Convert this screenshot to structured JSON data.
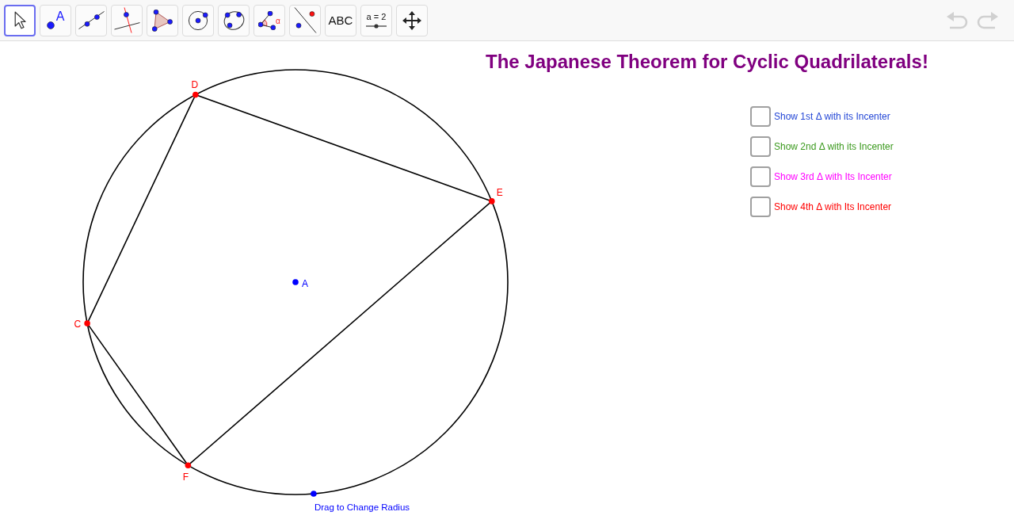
{
  "toolbar": {
    "tools": [
      {
        "kind": "move",
        "selected": true
      },
      {
        "kind": "point",
        "label": "A",
        "selected": false
      },
      {
        "kind": "line",
        "selected": false
      },
      {
        "kind": "perpendicular",
        "selected": false
      },
      {
        "kind": "polygon",
        "selected": false
      },
      {
        "kind": "circle",
        "selected": false
      },
      {
        "kind": "conic",
        "selected": false
      },
      {
        "kind": "angle",
        "label": "α",
        "selected": false
      },
      {
        "kind": "reflect",
        "selected": false
      },
      {
        "kind": "text",
        "label": "ABC",
        "selected": false
      },
      {
        "kind": "slider",
        "label": "a = 2",
        "selected": false
      },
      {
        "kind": "pan",
        "selected": false
      }
    ],
    "history": [
      {
        "kind": "undo",
        "disabled": true
      },
      {
        "kind": "redo",
        "disabled": true
      }
    ]
  },
  "title": "The Japanese Theorem for Cyclic Quadrilaterals!",
  "graphics": {
    "points": [
      {
        "kind": "vertex",
        "label": "D",
        "color": "#ff0000"
      },
      {
        "kind": "vertex",
        "label": "E",
        "color": "#ff0000"
      },
      {
        "kind": "vertex",
        "label": "F",
        "color": "#ff0000"
      },
      {
        "kind": "vertex",
        "label": "C",
        "color": "#ff0000"
      },
      {
        "kind": "center",
        "label": "A",
        "color": "#0000ff"
      },
      {
        "kind": "handle",
        "label": "Drag to Change Radius",
        "color": "#0000ff"
      }
    ]
  },
  "checkboxes": [
    {
      "label": "Show 1st Δ with its Incenter",
      "checked": false,
      "color": "#2447d6"
    },
    {
      "label": "Show 2nd Δ with its Incenter",
      "checked": false,
      "color": "#3c9a1f"
    },
    {
      "label": "Show 3rd Δ with Its Incenter",
      "checked": false,
      "color": "#ff00ff"
    },
    {
      "label": "Show 4th Δ with Its Incenter",
      "checked": false,
      "color": "#ff0000"
    }
  ]
}
